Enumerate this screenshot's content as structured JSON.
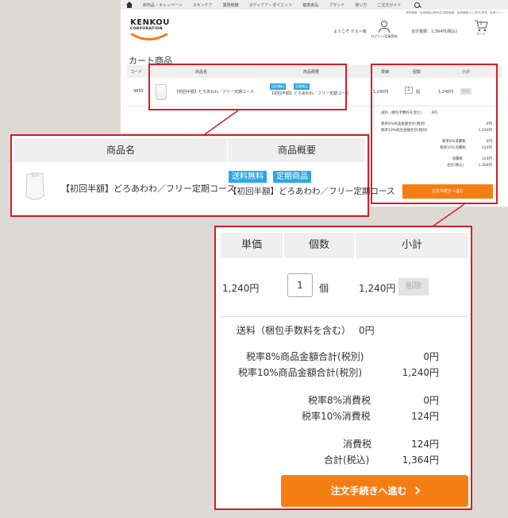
{
  "nav": {
    "items": [
      "新商品・キャンペーン",
      "スキンケア",
      "業務機器",
      "ボディケア・ダイエット",
      "健康食品",
      "ブランド",
      "使い方",
      "ご注文ガイド"
    ]
  },
  "notice": "業務機器・医療機器は販売店(業務機器・医療機器)のご案内(業務・医療)サイト",
  "logo": {
    "line1": "KENKOU",
    "line2": "CORPORATION"
  },
  "header": {
    "welcome": "ようこそ ゲスト様",
    "login_label": "ログイン/会員登録",
    "cart_total": "合計金額：1,364円(税込)",
    "cart_label": "カート",
    "cart_count": "1"
  },
  "cart": {
    "title": "カート商品",
    "code_header": "コード",
    "code": "9855",
    "product_header": "商品名",
    "overview_header": "商品概要",
    "product_name": "【初回半額】どろあわわ／フリー定期コース",
    "tags": [
      "送料無料",
      "定期商品"
    ],
    "overview_text": "【初回半額】どろあわわ／フリー定期コース",
    "unit_price_header": "単価",
    "qty_header": "個数",
    "subtotal_header": "小計",
    "unit_price": "1,240円",
    "qty": "1",
    "qty_unit": "個",
    "subtotal": "1,240円",
    "delete_label": "削除"
  },
  "summary": {
    "shipping_label": "送料（梱包手数料を含む）",
    "shipping_value": "0円",
    "rows": [
      {
        "label": "税率8%商品金額合計(税別)",
        "value": "0円"
      },
      {
        "label": "税率10%商品金額合計(税別)",
        "value": "1,240円"
      },
      {
        "label": "税率8%消費税",
        "value": "0円"
      },
      {
        "label": "税率10%消費税",
        "value": "124円"
      },
      {
        "label": "消費税",
        "value": "124円"
      },
      {
        "label": "合計(税込)",
        "value": "1,364円"
      }
    ],
    "order_button": "注文手続きへ進む"
  },
  "colors": {
    "highlight": "#d11f2a",
    "order_button": "#f57e14",
    "tag": "#2ea7e0",
    "logo_arc": "#f07a1a"
  }
}
